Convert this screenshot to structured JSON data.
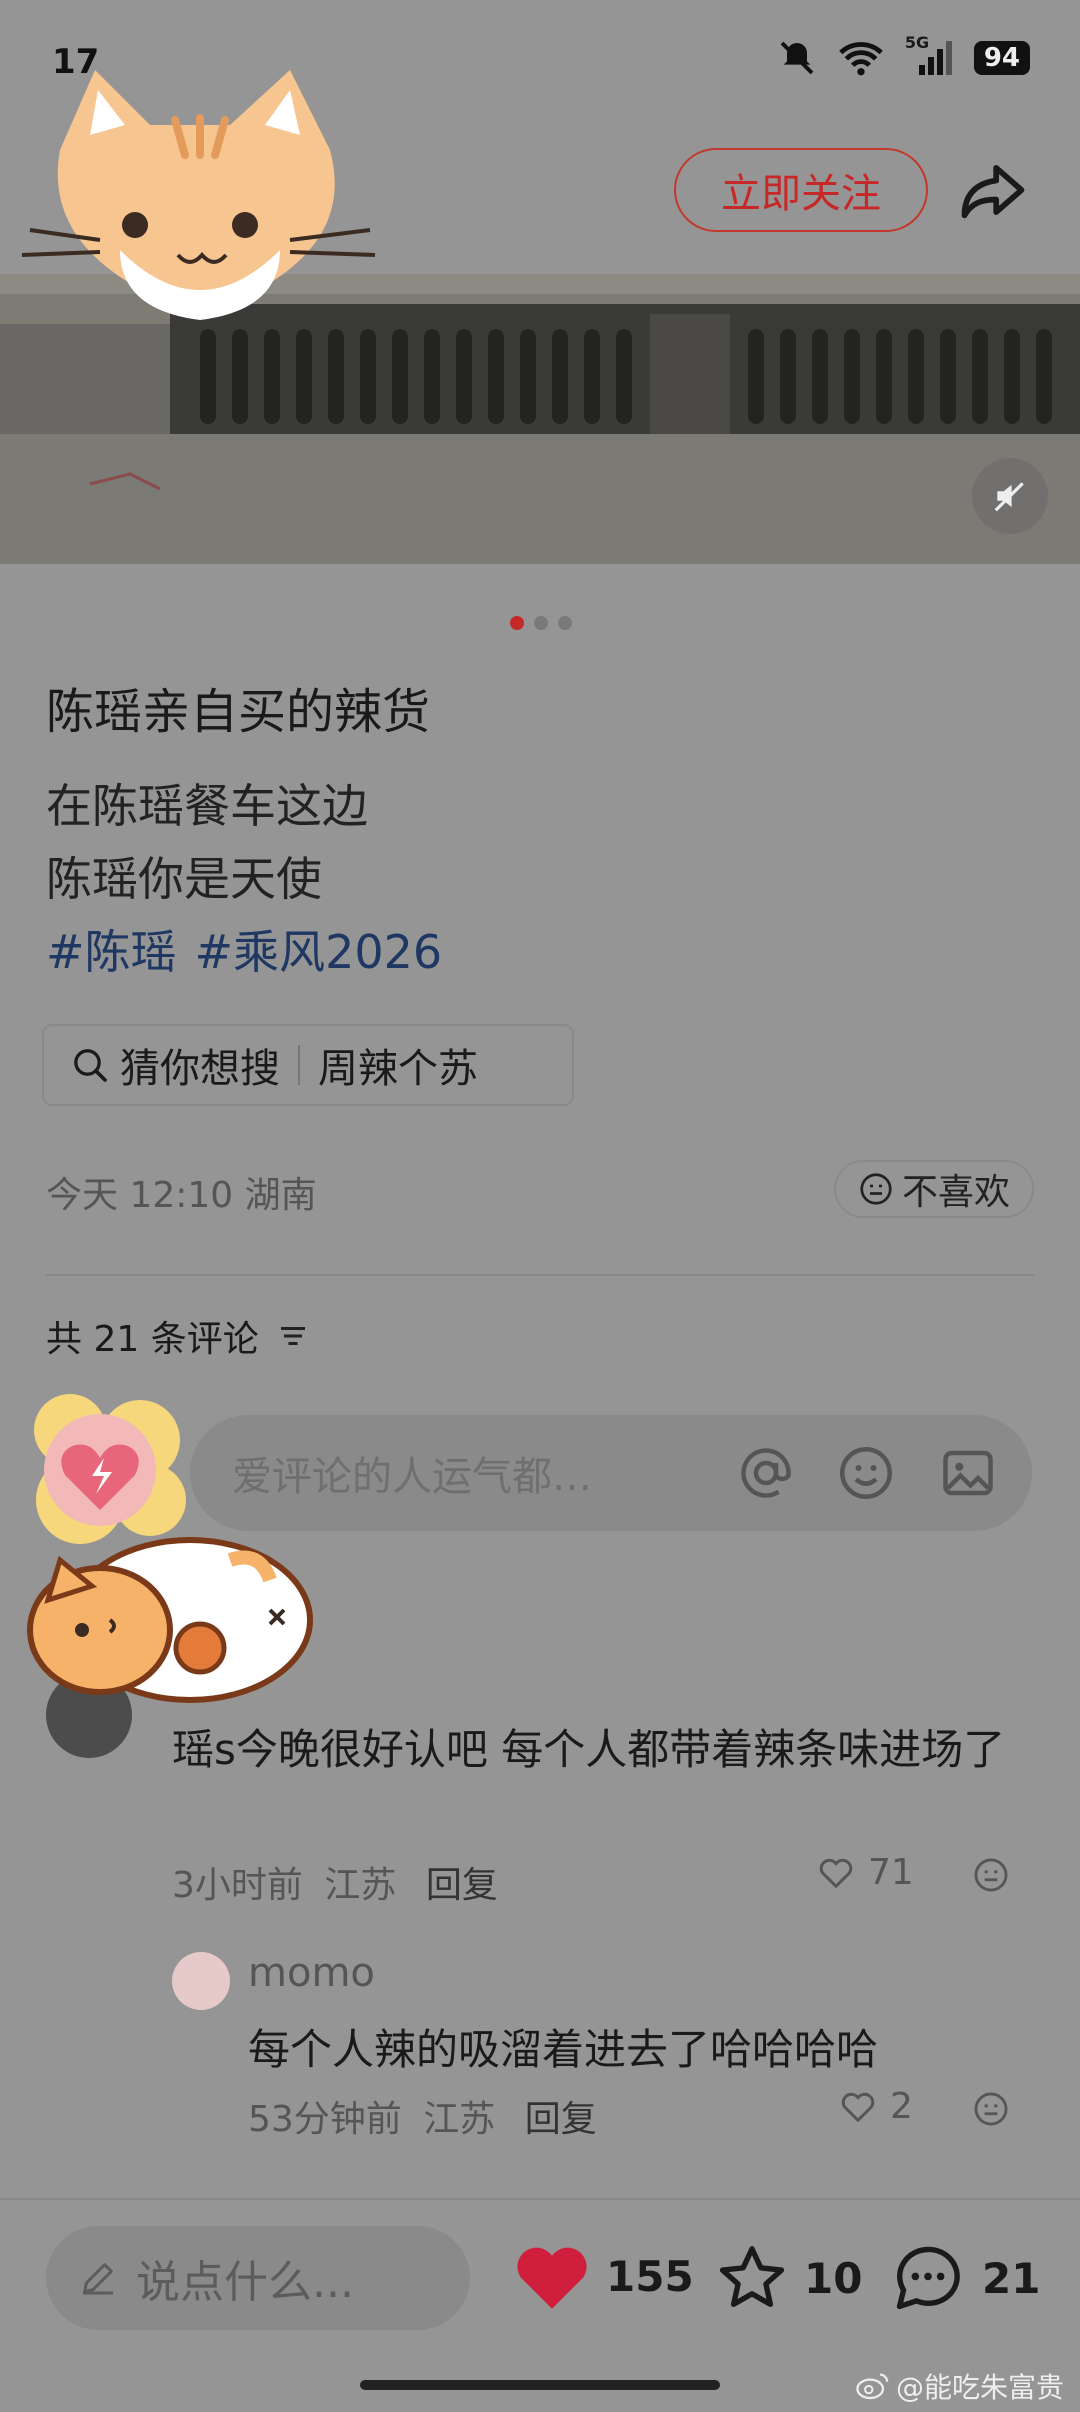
{
  "status_bar": {
    "time": "17",
    "signal_label": "5G",
    "battery": "94",
    "icons": [
      "mute-bell-icon",
      "wifi-icon",
      "signal-icon",
      "battery-icon"
    ]
  },
  "header": {
    "follow_label": "立即关注",
    "share_icon": "share-arrow-icon"
  },
  "post": {
    "title": "陈瑶亲自买的辣货",
    "lines": [
      "在陈瑶餐车这边",
      "陈瑶你是天使"
    ],
    "tags": [
      "#陈瑶",
      "#乘风2026"
    ],
    "image_count": 3,
    "active_image": 1
  },
  "guess_search": {
    "label": "猜你想搜",
    "suggestion": "周辣个苏"
  },
  "meta": {
    "time_location": "今天 12:10 湖南",
    "dislike_label": "不喜欢"
  },
  "comments_section": {
    "count_label": "共 21 条评论",
    "input_placeholder": "爱评论的人运气都…"
  },
  "comments": [
    {
      "text": "瑶s今晚很好认吧 每个人都带着辣条味进场了",
      "time": "3小时前",
      "location": "江苏",
      "reply_label": "回复",
      "likes": "71",
      "replies": [
        {
          "name": "momo",
          "text": "每个人辣的吸溜着进去了哈哈哈哈",
          "time": "53分钟前",
          "location": "江苏",
          "reply_label": "回复",
          "likes": "2"
        }
      ]
    }
  ],
  "bottom_bar": {
    "input_placeholder": "说点什么...",
    "likes": "155",
    "stars": "10",
    "comments": "21"
  },
  "watermark": "@能吃朱富贵",
  "colors": {
    "accent": "#c62828",
    "tag": "#1f3763",
    "overlay_bg": "#959595"
  }
}
